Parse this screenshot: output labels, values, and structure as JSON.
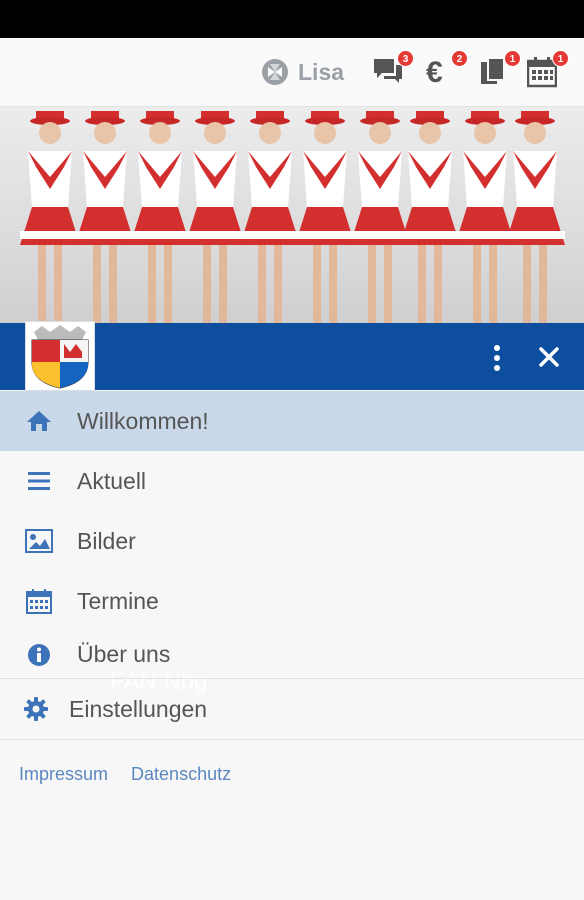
{
  "user": {
    "name": "Lisa",
    "icon": "user-logo-icon"
  },
  "notifications": [
    {
      "icon": "chat-icon",
      "count": "3"
    },
    {
      "icon": "euro-icon",
      "count": "2"
    },
    {
      "icon": "documents-icon",
      "count": "1"
    },
    {
      "icon": "calendar-icon",
      "count": "1"
    }
  ],
  "app": {
    "title": "FAN Nbg"
  },
  "nav": {
    "items": [
      {
        "label": "Willkommen!",
        "icon": "home-icon",
        "active": true
      },
      {
        "label": "Aktuell",
        "icon": "list-icon"
      },
      {
        "label": "Bilder",
        "icon": "image-icon"
      },
      {
        "label": "Termine",
        "icon": "calendar-icon"
      },
      {
        "label": "Über uns",
        "icon": "info-icon"
      }
    ],
    "settings": {
      "label": "Einstellungen",
      "icon": "gear-icon"
    }
  },
  "footer_links": {
    "impressum": "Impressum",
    "datenschutz": "Datenschutz"
  },
  "colors": {
    "app_bar": "#0d4f9e",
    "active_item": "#c9d9ea",
    "icon_blue": "#3d73b8",
    "badge": "#e53935"
  }
}
